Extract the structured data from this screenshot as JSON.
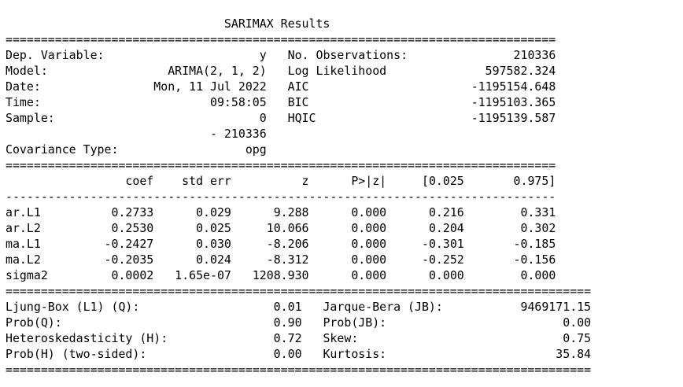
{
  "title": "SARIMAX Results",
  "model_info": {
    "rows": [
      {
        "left_label": "Dep. Variable:",
        "left_value": "y",
        "right_label": "No. Observations:",
        "right_value": "210336"
      },
      {
        "left_label": "Model:",
        "left_value": "ARIMA(2, 1, 2)",
        "right_label": "Log Likelihood",
        "right_value": "597582.324"
      },
      {
        "left_label": "Date:",
        "left_value": "Mon, 11 Jul 2022",
        "right_label": "AIC",
        "right_value": "-1195154.648"
      },
      {
        "left_label": "Time:",
        "left_value": "09:58:05",
        "right_label": "BIC",
        "right_value": "-1195103.365"
      },
      {
        "left_label": "Sample:",
        "left_value": "0",
        "right_label": "HQIC",
        "right_value": "-1195139.587"
      },
      {
        "left_label": "",
        "left_value": "- 210336",
        "right_label": "",
        "right_value": ""
      },
      {
        "left_label": "Covariance Type:",
        "left_value": "opg",
        "right_label": "",
        "right_value": ""
      }
    ]
  },
  "coef_table": {
    "headers": [
      "",
      "coef",
      "std err",
      "z",
      "P>|z|",
      "[0.025",
      "0.975]"
    ],
    "rows": [
      [
        "ar.L1",
        "0.2733",
        "0.029",
        "9.288",
        "0.000",
        "0.216",
        "0.331"
      ],
      [
        "ar.L2",
        "0.2530",
        "0.025",
        "10.066",
        "0.000",
        "0.204",
        "0.302"
      ],
      [
        "ma.L1",
        "-0.2427",
        "0.030",
        "-8.206",
        "0.000",
        "-0.301",
        "-0.185"
      ],
      [
        "ma.L2",
        "-0.2035",
        "0.024",
        "-8.312",
        "0.000",
        "-0.252",
        "-0.156"
      ],
      [
        "sigma2",
        "0.0002",
        "1.65e-07",
        "1208.930",
        "0.000",
        "0.000",
        "0.000"
      ]
    ]
  },
  "diagnostics": {
    "rows": [
      {
        "left_label": "Ljung-Box (L1) (Q):",
        "left_value": "0.01",
        "right_label": "Jarque-Bera (JB):",
        "right_value": "9469171.15"
      },
      {
        "left_label": "Prob(Q):",
        "left_value": "0.90",
        "right_label": "Prob(JB):",
        "right_value": "0.00"
      },
      {
        "left_label": "Heteroskedasticity (H):",
        "left_value": "0.72",
        "right_label": "Skew:",
        "right_value": "0.75"
      },
      {
        "left_label": "Prob(H) (two-sided):",
        "left_value": "0.00",
        "right_label": "Kurtosis:",
        "right_value": "35.84"
      }
    ]
  }
}
